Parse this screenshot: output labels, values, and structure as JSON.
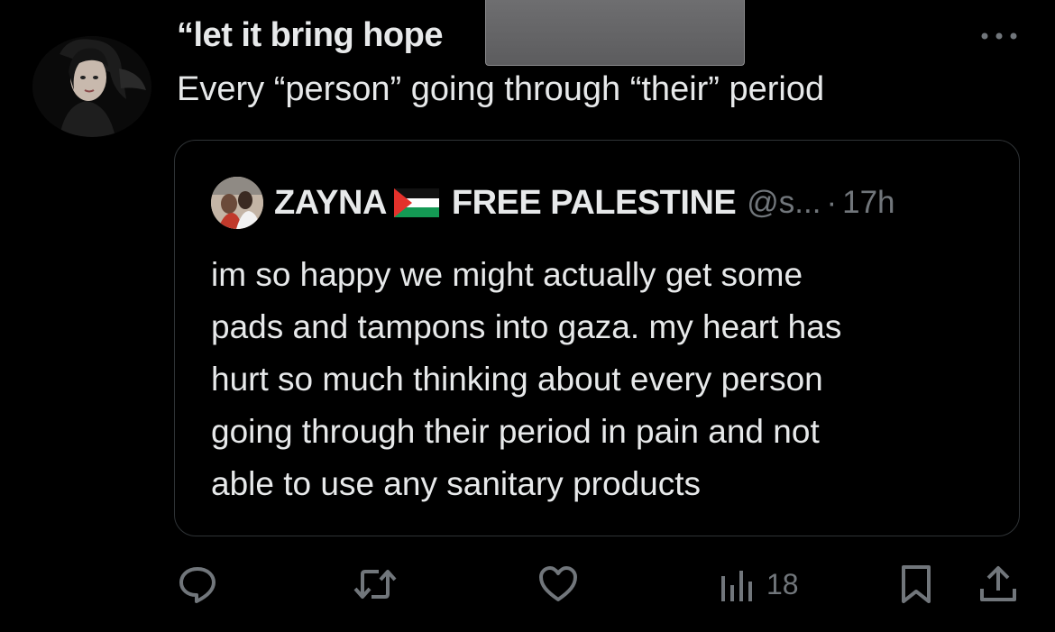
{
  "tweet": {
    "author_name": "“let it bring hope",
    "text": "Every “person” going through “their” period"
  },
  "quote": {
    "name": "ZAYNA",
    "name_suffix": "FREE PALESTINE",
    "handle": "@s...",
    "separator": "·",
    "time": "17h",
    "lines": [
      "im so happy we might actually get some",
      "pads and tampons into gaza. my heart has",
      "hurt so much thinking about every person",
      "going through their period in pain and not",
      "able to use any sanitary products"
    ]
  },
  "actions": {
    "views": "18"
  },
  "icons": {
    "more": "more-icon",
    "reply": "reply-icon",
    "retweet": "retweet-icon",
    "like": "heart-icon",
    "views": "views-icon",
    "bookmark": "bookmark-icon",
    "share": "share-icon",
    "flag": "palestine-flag-icon"
  },
  "colors": {
    "background": "#000000",
    "text": "#e7e9ea",
    "secondary": "#71767b",
    "border": "#2f3336"
  }
}
